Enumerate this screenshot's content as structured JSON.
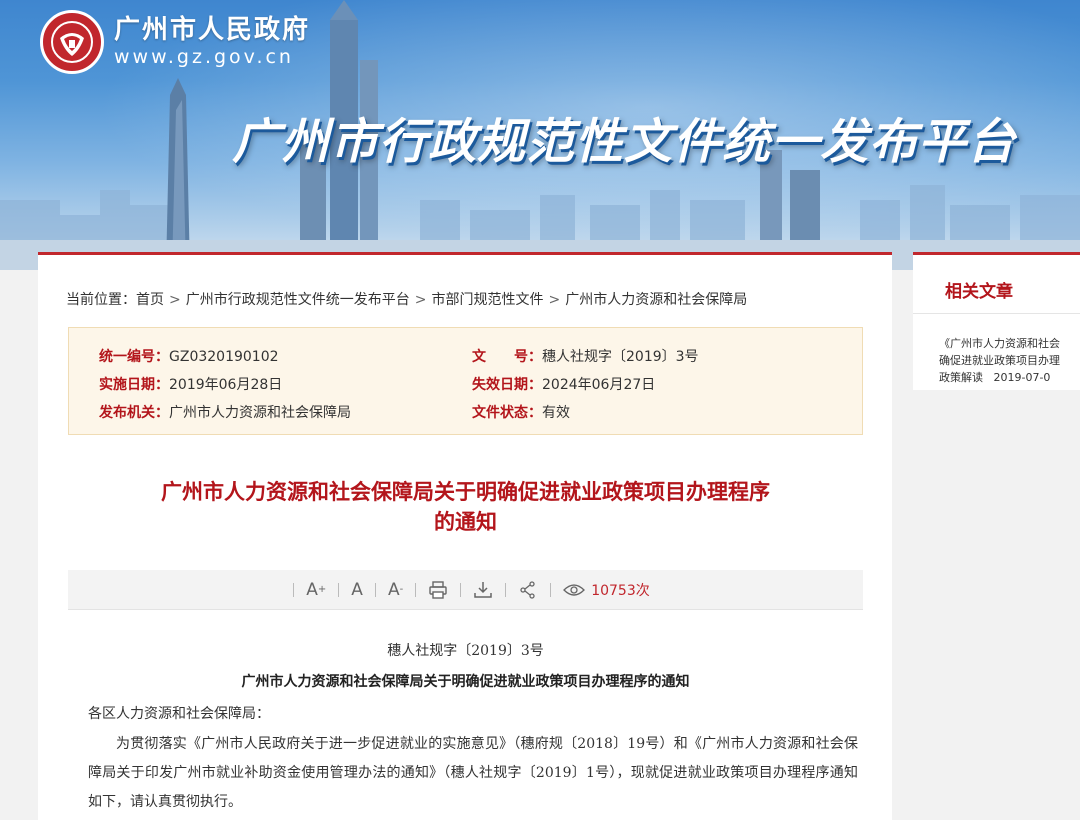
{
  "header": {
    "site_name": "广州市人民政府",
    "site_url": "www.gz.gov.cn",
    "platform_title": "广州市行政规范性文件统一发布平台"
  },
  "breadcrumb": {
    "prefix": "当前位置：",
    "items": [
      "首页",
      "广州市行政规范性文件统一发布平台",
      "市部门规范性文件",
      "广州市人力资源和社会保障局"
    ],
    "separator": ">"
  },
  "meta": {
    "serial_label": "统一编号：",
    "serial_value": "GZ0320190102",
    "doc_no_label": "文　　号：",
    "doc_no_value": "穗人社规字〔2019〕3号",
    "effective_label": "实施日期：",
    "effective_value": "2019年06月28日",
    "expiry_label": "失效日期：",
    "expiry_value": "2024年06月27日",
    "issuer_label": "发布机关：",
    "issuer_value": "广州市人力资源和社会保障局",
    "status_label": "文件状态：",
    "status_value": "有效"
  },
  "document": {
    "title_line1": "广州市人力资源和社会保障局关于明确促进就业政策项目办理程序",
    "title_line2": "的通知",
    "number": "穗人社规字〔2019〕3号",
    "subtitle": "广州市人力资源和社会保障局关于明确促进就业政策项目办理程序的通知",
    "addressee": "各区人力资源和社会保障局：",
    "body": "为贯彻落实《广州市人民政府关于进一步促进就业的实施意见》（穗府规〔2018〕19号）和《广州市人力资源和社会保障局关于印发广州市就业补助资金使用管理办法的通知》（穗人社规字〔2019〕1号），现就促进就业政策项目办理程序通知如下，请认真贯彻执行。"
  },
  "toolbar": {
    "font_increase": "A",
    "font_increase_sup": "+",
    "font_normal": "A",
    "font_decrease": "A",
    "font_decrease_sup": "-",
    "views": "10753次"
  },
  "sidebar": {
    "title": "相关文章",
    "article_line1": "《广州市人力资源和社会",
    "article_line2": "确促进就业政策项目办理",
    "article_type": "政策解读",
    "article_date": "2019-07-0"
  },
  "colors": {
    "brand_red": "#c1272d",
    "title_red": "#b3151b",
    "meta_bg": "#fdf6e9"
  },
  "icons": [
    "emblem-icon",
    "print-icon",
    "download-icon",
    "share-icon",
    "eye-icon"
  ]
}
